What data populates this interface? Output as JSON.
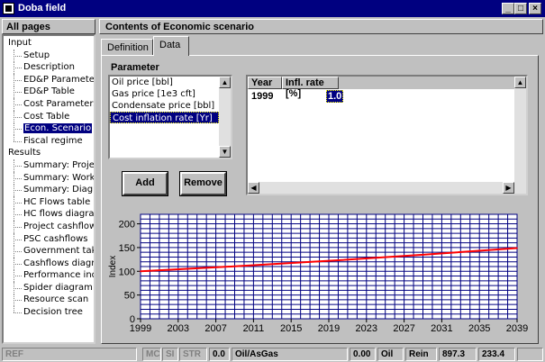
{
  "window": {
    "title": "Doba field"
  },
  "left_panel": {
    "header": "All pages",
    "tree": [
      {
        "label": "Input",
        "level": 0
      },
      {
        "label": "Setup",
        "level": 1
      },
      {
        "label": "Description",
        "level": 1
      },
      {
        "label": "ED&P Paramete",
        "level": 1
      },
      {
        "label": "ED&P Table",
        "level": 1
      },
      {
        "label": "Cost Parameters",
        "level": 1
      },
      {
        "label": "Cost Table",
        "level": 1
      },
      {
        "label": "Econ. Scenario",
        "level": 1,
        "selected": true
      },
      {
        "label": "Fiscal regime",
        "level": 1,
        "last": true
      },
      {
        "label": "Results",
        "level": 0
      },
      {
        "label": "Summary: Proje",
        "level": 1
      },
      {
        "label": "Summary: Work",
        "level": 1
      },
      {
        "label": "Summary: Diagr",
        "level": 1
      },
      {
        "label": "HC Flows table",
        "level": 1
      },
      {
        "label": "HC flows diagran",
        "level": 1
      },
      {
        "label": "Project cashflow",
        "level": 1
      },
      {
        "label": "PSC cashflows",
        "level": 1
      },
      {
        "label": "Government take",
        "level": 1
      },
      {
        "label": "Cashflows diagra",
        "level": 1
      },
      {
        "label": "Performance ind.",
        "level": 1
      },
      {
        "label": "Spider diagram",
        "level": 1
      },
      {
        "label": "Resource scan",
        "level": 1
      },
      {
        "label": "Decision tree",
        "level": 1,
        "last": true
      }
    ]
  },
  "right_panel": {
    "header": "Contents of Economic scenario",
    "tabs": [
      {
        "label": "Definition"
      },
      {
        "label": "Data",
        "active": true
      }
    ],
    "parameter_label": "Parameter",
    "parameters": [
      {
        "label": "Oil price [bbl]"
      },
      {
        "label": "Gas price [1e3 cft]"
      },
      {
        "label": "Condensate price [bbl]"
      },
      {
        "label": "Cost inflation rate [Yr]",
        "selected": true
      }
    ],
    "add_button": "Add",
    "remove_button": "Remove",
    "grid": {
      "headers": [
        "Year",
        "Infl. rate [%]"
      ],
      "rows": [
        {
          "year": "1999",
          "rate": "1.0"
        }
      ]
    }
  },
  "chart_data": {
    "type": "line",
    "ylabel": "Index",
    "xlabel": "",
    "x_ticks": [
      "1999",
      "2003",
      "2007",
      "2011",
      "2015",
      "2019",
      "2023",
      "2027",
      "2031",
      "2035",
      "2039"
    ],
    "y_ticks": [
      "0",
      "50",
      "100",
      "150",
      "200"
    ],
    "xlim": [
      1999,
      2039
    ],
    "ylim": [
      0,
      220
    ],
    "grid": true,
    "series": [
      {
        "color": "#ff0000",
        "x": [
          1999,
          2009,
          2019,
          2029,
          2039
        ],
        "values": [
          100,
          110.5,
          122.0,
          134.8,
          148.9
        ]
      }
    ],
    "colors": {
      "background": "#ffffff",
      "grid": "#000080",
      "line": "#ff0000"
    }
  },
  "status_bar": {
    "ref": "REF",
    "mc": "MC",
    "si": "SI",
    "str": "STR",
    "v1": "0.0",
    "product": "Oil/AsGas",
    "v2": "0.00",
    "oil": "Oil",
    "rein": "Rein",
    "v3": "897.3",
    "v4": "233.4"
  }
}
